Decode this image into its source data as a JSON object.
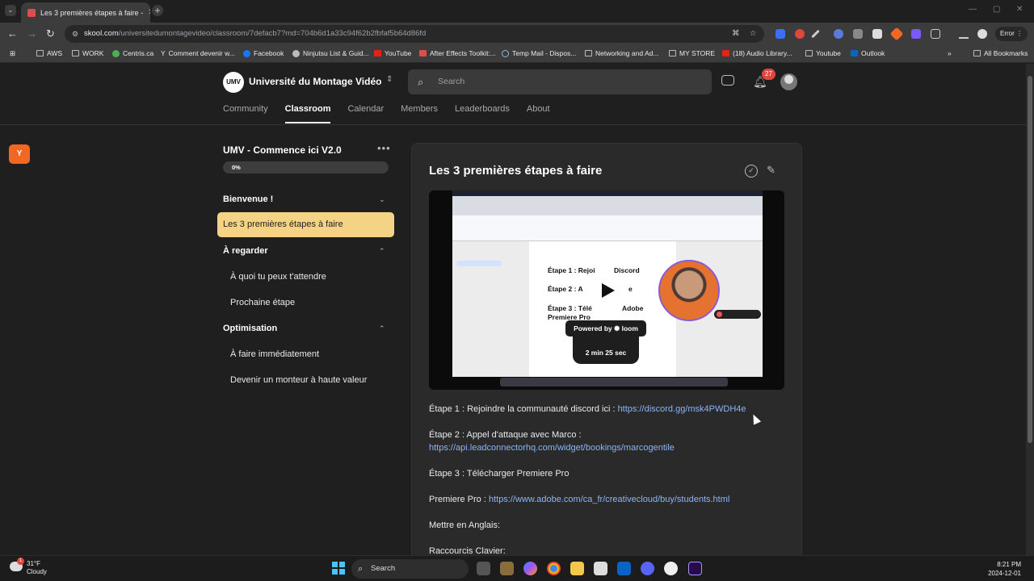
{
  "browser": {
    "tab_title": "Les 3 premières étapes à faire -",
    "url_host": "skool.com",
    "url_path": "/universitedumontagevideo/classroom/7defacb7?md=704b6d1a33c94f62b2fbfaf5b64d86fd",
    "error_label": "Error",
    "bookmarks": [
      "AWS",
      "WORK",
      "Centris.ca",
      "Comment devenir w...",
      "Facebook",
      "Ninjutsu List & Guid...",
      "YouTube",
      "After Effects Toolkit:...",
      "Temp Mail - Dispos...",
      "Networking and Ad...",
      "MY STORE",
      "(18) Audio Library...",
      "Youtube",
      "Outlook"
    ],
    "all_bookmarks": "All Bookmarks"
  },
  "site": {
    "logo_text": "UMV",
    "name": "Université du Montage Vidéo",
    "search_placeholder": "Search",
    "notification_count": "27",
    "nav": [
      "Community",
      "Classroom",
      "Calendar",
      "Members",
      "Leaderboards",
      "About"
    ],
    "active_nav": "Classroom",
    "side_badge": "Y"
  },
  "course": {
    "title": "UMV - Commence ici V2.0",
    "progress_label": "0%",
    "progress": 0,
    "sections": [
      {
        "title": "Bienvenue !",
        "lessons": [
          "Les 3 premières étapes à faire"
        ]
      },
      {
        "title": "À regarder",
        "lessons": [
          "À quoi tu peux t'attendre",
          "Prochaine étape"
        ]
      },
      {
        "title": "Optimisation",
        "lessons": [
          "À faire immédiatement",
          "Devenir un monteur à haute valeur"
        ]
      }
    ]
  },
  "lesson": {
    "title": "Les 3 premières étapes à faire",
    "video": {
      "doc_line1": "Étape 1 : Rejoi",
      "doc_line1b": "Discord",
      "doc_line2": "Étape 2 : A",
      "doc_line2b": "e",
      "doc_line3": "Étape 3 : Télé",
      "doc_line3b": "Adobe",
      "doc_line4": "Premiere Pro",
      "powered_by": "Powered by  ✺ loom",
      "duration": "2 min 25 sec"
    },
    "paragraphs": [
      {
        "text": "Étape 1 : Rejoindre la communauté discord ici : ",
        "link": "https://discord.gg/msk4PWDH4e"
      },
      {
        "text": "Étape 2 : Appel d'attaque avec Marco :",
        "link": ""
      },
      {
        "text": "",
        "link": "https://api.leadconnectorhq.com/widget/bookings/marcogentile"
      },
      {
        "text": "Étape 3 : Télécharger Premiere Pro",
        "link": ""
      },
      {
        "text": "Premiere Pro : ",
        "link": "https://www.adobe.com/ca_fr/creativecloud/buy/students.html"
      },
      {
        "text": "Mettre en Anglais:",
        "link": ""
      },
      {
        "text": "Raccourcis Clavier:",
        "link": ""
      }
    ]
  },
  "taskbar": {
    "weather_temp": "31°F",
    "weather_desc": "Cloudy",
    "weather_badge": "1",
    "search_label": "Search",
    "time": "8:21 PM",
    "date": "2024-12-01"
  }
}
